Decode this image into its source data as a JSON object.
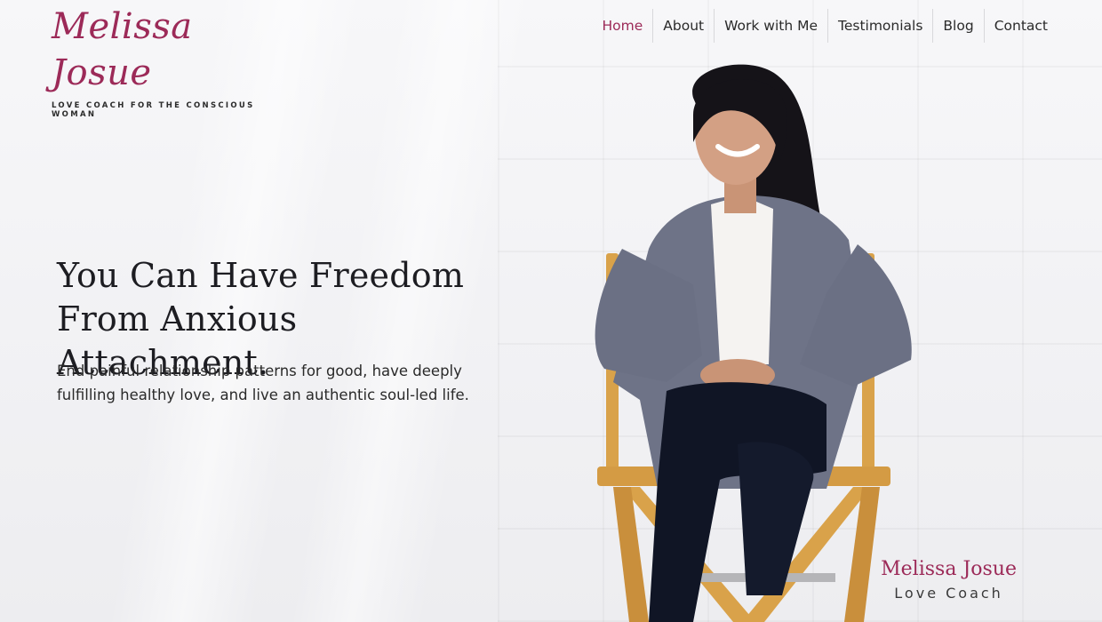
{
  "brand": {
    "logo_text": "Melissa Josue",
    "tagline": "LOVE COACH FOR THE CONSCIOUS WOMAN",
    "accent_color": "#9c2a58"
  },
  "nav": {
    "items": [
      {
        "label": "Home",
        "active": true
      },
      {
        "label": "About"
      },
      {
        "label": "Work with Me"
      },
      {
        "label": "Testimonials"
      },
      {
        "label": "Blog"
      },
      {
        "label": "Contact"
      }
    ]
  },
  "hero": {
    "title_line1": "You Can Have Freedom",
    "title_line2": "From Anxious Attachment.",
    "subtitle_line1": "End painful relationship patterns for good, have deeply",
    "subtitle_line2": "fulfilling healthy love, and live an authentic soul-led life."
  },
  "signature": {
    "name": "Melissa Josue",
    "role": "Love Coach"
  }
}
